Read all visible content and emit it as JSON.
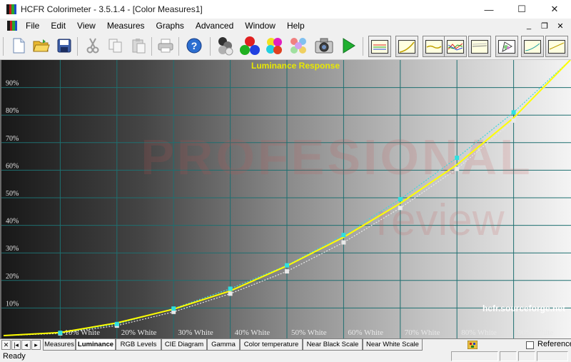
{
  "window": {
    "title": "HCFR Colorimeter - 3.5.1.4 - [Color Measures1]",
    "controls": {
      "minimize": "—",
      "maximize": "☐",
      "close": "✕"
    }
  },
  "menu": {
    "items": [
      "File",
      "Edit",
      "View",
      "Measures",
      "Graphs",
      "Advanced",
      "Window",
      "Help"
    ],
    "mdi": {
      "minimize": "_",
      "restore": "❐",
      "close": "✕"
    }
  },
  "toolbar": {
    "buttons": [
      "new-document",
      "open-folder",
      "save",
      "cut",
      "copy",
      "paste",
      "print",
      "help",
      "measure-gray",
      "measure-primaries",
      "measure-secondaries",
      "measure-saturations",
      "capture-camera",
      "run-continuous"
    ],
    "graph_buttons": [
      "view-rgb",
      "view-luminance",
      "view-gamma",
      "view-rgb-levels",
      "view-color-temp",
      "view-cie",
      "view-near-black",
      "view-near-white"
    ]
  },
  "chart": {
    "watermark_top": "PROFESIONAL",
    "watermark_bottom": "review",
    "site_label": "hcfr.sourceforge.net"
  },
  "chart_data": {
    "type": "line",
    "title": "Luminance Response",
    "x": [
      0,
      10,
      20,
      30,
      40,
      50,
      60,
      70,
      80,
      90,
      100
    ],
    "x_tick_labels": [
      "10% White",
      "20% White",
      "30% White",
      "40% White",
      "50% White",
      "60% White",
      "70% White",
      "80% White",
      "90% White"
    ],
    "y_tick_labels": [
      "10%",
      "20%",
      "30%",
      "40%",
      "50%",
      "60%",
      "70%",
      "80%",
      "90%"
    ],
    "xlim": [
      0,
      100
    ],
    "ylim": [
      0,
      100
    ],
    "grid": true,
    "series": [
      {
        "color": "#ffff00",
        "style": "solid",
        "values": [
          0,
          1.1,
          4.6,
          9.6,
          16.2,
          25.3,
          35.7,
          48.0,
          62.0,
          79.0,
          100
        ]
      },
      {
        "color": "#40d8d8",
        "style": "dotted",
        "values": [
          0,
          1.0,
          4.2,
          9.8,
          17.0,
          25.5,
          36.5,
          49.5,
          64.5,
          81.0,
          100
        ]
      },
      {
        "color": "#e8e8e8",
        "style": "dotted",
        "values": [
          0,
          0.8,
          3.6,
          8.6,
          15.2,
          23.3,
          33.8,
          46.3,
          60.5,
          78.0,
          100
        ]
      }
    ]
  },
  "tabs": {
    "items": [
      "Measures",
      "Luminance",
      "RGB Levels",
      "CIE Diagram",
      "Gamma",
      "Color temperature",
      "Near Black Scale",
      "Near White Scale"
    ],
    "active": "Luminance",
    "reference_label": "Reference"
  },
  "status": {
    "text": "Ready"
  }
}
